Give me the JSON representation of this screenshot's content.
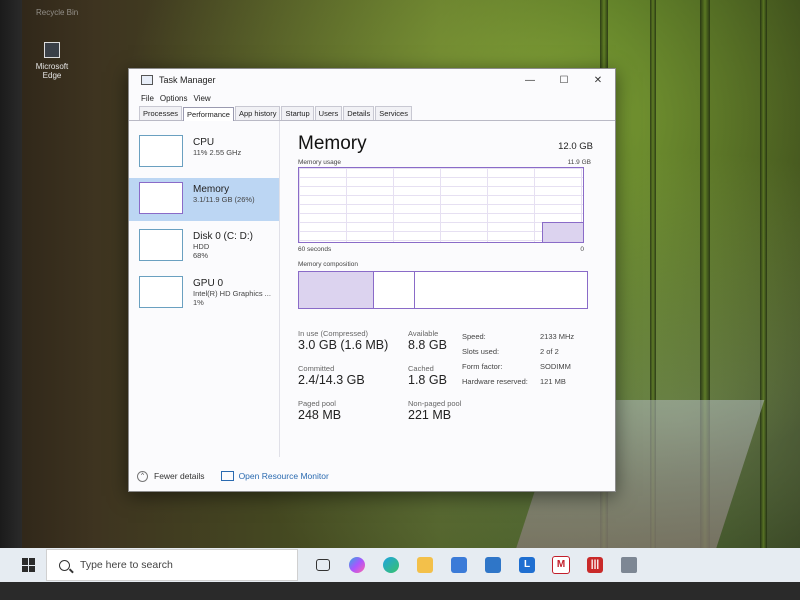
{
  "desktop": {
    "recycle_bin_label": "Recycle Bin",
    "edge_label": "Microsoft Edge"
  },
  "window": {
    "title": "Task Manager",
    "controls": [
      "—",
      "☐",
      "✕"
    ]
  },
  "menu": [
    "File",
    "Options",
    "View"
  ],
  "tabs": [
    "Processes",
    "Performance",
    "App history",
    "Startup",
    "Users",
    "Details",
    "Services"
  ],
  "active_tab": "Performance",
  "resources": [
    {
      "name": "CPU",
      "sub1": "11%  2.55 GHz",
      "sub2": ""
    },
    {
      "name": "Memory",
      "sub1": "3.1/11.9 GB (26%)",
      "sub2": ""
    },
    {
      "name": "Disk 0 (C: D:)",
      "sub1": "HDD",
      "sub2": "68%"
    },
    {
      "name": "GPU 0",
      "sub1": "Intel(R) HD Graphics ...",
      "sub2": "1%"
    }
  ],
  "memory_panel": {
    "title": "Memory",
    "total": "12.0 GB",
    "usage_label": "Memory usage",
    "usage_max": "11.9 GB",
    "usage_fraction": 0.26,
    "time_left": "60 seconds",
    "time_right": "0",
    "composition_label": "Memory composition",
    "stats": {
      "in_use_label": "In use (Compressed)",
      "in_use_value": "3.0 GB (1.6 MB)",
      "available_label": "Available",
      "available_value": "8.8 GB",
      "committed_label": "Committed",
      "committed_value": "2.4/14.3 GB",
      "cached_label": "Cached",
      "cached_value": "1.8 GB",
      "paged_label": "Paged pool",
      "paged_value": "248 MB",
      "nonpaged_label": "Non-paged pool",
      "nonpaged_value": "221 MB"
    },
    "details": [
      {
        "key": "Speed:",
        "value": "2133 MHz"
      },
      {
        "key": "Slots used:",
        "value": "2 of 2"
      },
      {
        "key": "Form factor:",
        "value": "SODIMM"
      },
      {
        "key": "Hardware reserved:",
        "value": "121 MB"
      }
    ]
  },
  "footer": {
    "fewer_details": "Fewer details",
    "open_monitor": "Open Resource Monitor"
  },
  "taskbar": {
    "search_placeholder": "Type here to search",
    "icons": [
      "task-view",
      "copilot",
      "edge",
      "file-explorer",
      "store",
      "mail",
      "l-app",
      "mcafee",
      "red-app",
      "task-manager"
    ]
  },
  "colors": {
    "memory_accent": "#8a6bc8",
    "selected_bg": "#bcd6f3",
    "link": "#2a6ab0"
  }
}
